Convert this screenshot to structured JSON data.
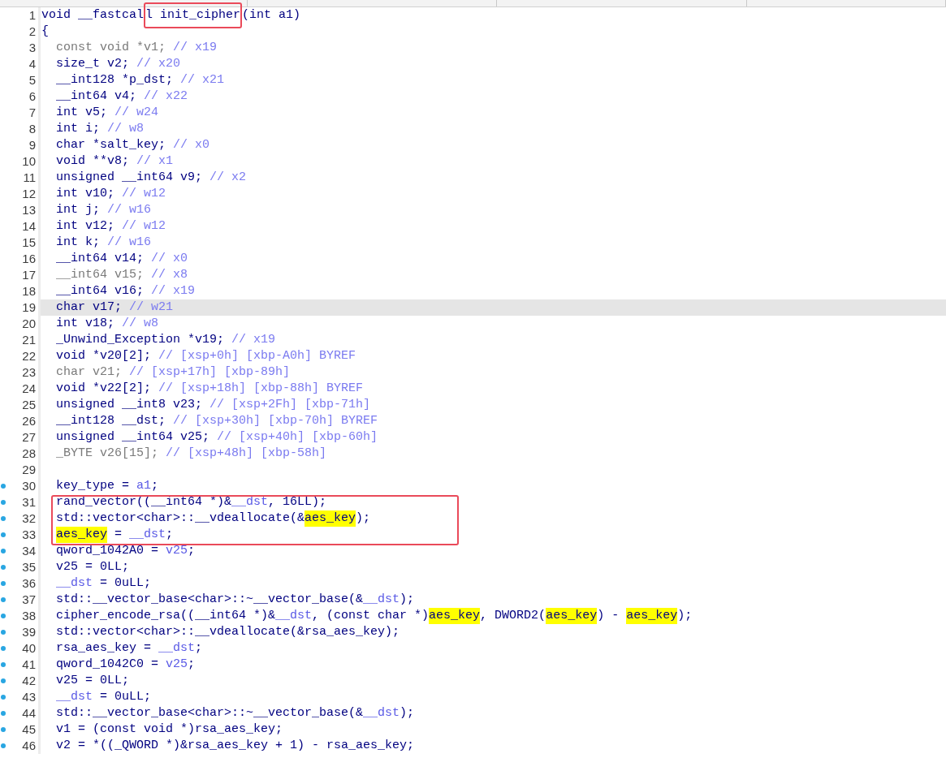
{
  "code_view": {
    "lines": [
      {
        "number": "1",
        "selected": false,
        "marked": false,
        "tokens": [
          {
            "kind": "code",
            "text": "void __fastcal"
          },
          {
            "kind": "boxed",
            "text": "l init_cipher"
          },
          {
            "kind": "code",
            "text": "(int a1)"
          }
        ]
      },
      {
        "number": "2",
        "selected": false,
        "marked": false,
        "tokens": [
          {
            "kind": "code",
            "text": "{"
          }
        ],
        "children": [
          {
            "number": "3",
            "selected": false,
            "marked": false,
            "tokens": [
              {
                "kind": "dim",
                "text": "const void *v1;"
              },
              {
                "kind": "comment",
                "text": " // x19"
              }
            ]
          },
          {
            "number": "4",
            "selected": false,
            "marked": false,
            "tokens": [
              {
                "kind": "code",
                "text": "size_t v2;"
              },
              {
                "kind": "comment",
                "text": " // x20"
              }
            ]
          },
          {
            "number": "5",
            "selected": false,
            "marked": false,
            "tokens": [
              {
                "kind": "code",
                "text": "__int128 *p_dst;"
              },
              {
                "kind": "comment",
                "text": " // x21"
              }
            ]
          },
          {
            "number": "6",
            "selected": false,
            "marked": false,
            "tokens": [
              {
                "kind": "code",
                "text": "__int64 v4;"
              },
              {
                "kind": "comment",
                "text": " // x22"
              }
            ]
          },
          {
            "number": "7",
            "selected": false,
            "marked": false,
            "tokens": [
              {
                "kind": "code",
                "text": "int v5;"
              },
              {
                "kind": "comment",
                "text": " // w24"
              }
            ]
          },
          {
            "number": "8",
            "selected": false,
            "marked": false,
            "tokens": [
              {
                "kind": "code",
                "text": "int i;"
              },
              {
                "kind": "comment",
                "text": " // w8"
              }
            ]
          },
          {
            "number": "9",
            "selected": false,
            "marked": false,
            "tokens": [
              {
                "kind": "code",
                "text": "char *salt_key;"
              },
              {
                "kind": "comment",
                "text": " // x0"
              }
            ]
          },
          {
            "number": "10",
            "selected": false,
            "marked": false,
            "tokens": [
              {
                "kind": "code",
                "text": "void **v8;"
              },
              {
                "kind": "comment",
                "text": " // x1"
              }
            ]
          },
          {
            "number": "11",
            "selected": false,
            "marked": false,
            "tokens": [
              {
                "kind": "code",
                "text": "unsigned __int64 v9;"
              },
              {
                "kind": "comment",
                "text": " // x2"
              }
            ]
          },
          {
            "number": "12",
            "selected": false,
            "marked": false,
            "tokens": [
              {
                "kind": "code",
                "text": "int v10;"
              },
              {
                "kind": "comment",
                "text": " // w12"
              }
            ]
          },
          {
            "number": "13",
            "selected": false,
            "marked": false,
            "tokens": [
              {
                "kind": "code",
                "text": "int j;"
              },
              {
                "kind": "comment",
                "text": " // w16"
              }
            ]
          },
          {
            "number": "14",
            "selected": false,
            "marked": false,
            "tokens": [
              {
                "kind": "code",
                "text": "int v12;"
              },
              {
                "kind": "comment",
                "text": " // w12"
              }
            ]
          },
          {
            "number": "15",
            "selected": false,
            "marked": false,
            "tokens": [
              {
                "kind": "code",
                "text": "int k;"
              },
              {
                "kind": "comment",
                "text": " // w16"
              }
            ]
          },
          {
            "number": "16",
            "selected": false,
            "marked": false,
            "tokens": [
              {
                "kind": "code",
                "text": "__int64 v14;"
              },
              {
                "kind": "comment",
                "text": " // x0"
              }
            ]
          },
          {
            "number": "17",
            "selected": false,
            "marked": false,
            "tokens": [
              {
                "kind": "dim",
                "text": "__int64 v15;"
              },
              {
                "kind": "comment",
                "text": " // x8"
              }
            ]
          },
          {
            "number": "18",
            "selected": false,
            "marked": false,
            "tokens": [
              {
                "kind": "code",
                "text": "__int64 v16;"
              },
              {
                "kind": "comment",
                "text": " // x19"
              }
            ]
          },
          {
            "number": "19",
            "selected": true,
            "marked": false,
            "tokens": [
              {
                "kind": "code",
                "text": "char v17;"
              },
              {
                "kind": "comment",
                "text": " // w21"
              }
            ]
          },
          {
            "number": "20",
            "selected": false,
            "marked": false,
            "tokens": [
              {
                "kind": "code",
                "text": "int v18;"
              },
              {
                "kind": "comment",
                "text": " // w8"
              }
            ]
          },
          {
            "number": "21",
            "selected": false,
            "marked": false,
            "tokens": [
              {
                "kind": "code",
                "text": "_Unwind_Exception *v19;"
              },
              {
                "kind": "comment",
                "text": " // x19"
              }
            ]
          },
          {
            "number": "22",
            "selected": false,
            "marked": false,
            "tokens": [
              {
                "kind": "code",
                "text": "void *v20[2];"
              },
              {
                "kind": "comment",
                "text": " // [xsp+0h] [xbp-A0h] BYREF"
              }
            ]
          },
          {
            "number": "23",
            "selected": false,
            "marked": false,
            "tokens": [
              {
                "kind": "dim",
                "text": "char v21;"
              },
              {
                "kind": "comment",
                "text": " // [xsp+17h] [xbp-89h]"
              }
            ]
          },
          {
            "number": "24",
            "selected": false,
            "marked": false,
            "tokens": [
              {
                "kind": "code",
                "text": "void *v22[2];"
              },
              {
                "kind": "comment",
                "text": " // [xsp+18h] [xbp-88h] BYREF"
              }
            ]
          },
          {
            "number": "25",
            "selected": false,
            "marked": false,
            "tokens": [
              {
                "kind": "code",
                "text": "unsigned __int8 v23;"
              },
              {
                "kind": "comment",
                "text": " // [xsp+2Fh] [xbp-71h]"
              }
            ]
          },
          {
            "number": "26",
            "selected": false,
            "marked": false,
            "tokens": [
              {
                "kind": "code",
                "text": "__int128 __dst;"
              },
              {
                "kind": "comment",
                "text": " // [xsp+30h] [xbp-70h] BYREF"
              }
            ]
          },
          {
            "number": "27",
            "selected": false,
            "marked": false,
            "tokens": [
              {
                "kind": "code",
                "text": "unsigned __int64 v25;"
              },
              {
                "kind": "comment",
                "text": " // [xsp+40h] [xbp-60h]"
              }
            ]
          },
          {
            "number": "28",
            "selected": false,
            "marked": false,
            "tokens": [
              {
                "kind": "dim",
                "text": "_BYTE v26[15];"
              },
              {
                "kind": "comment",
                "text": " // [xsp+48h] [xbp-58h]"
              }
            ]
          },
          {
            "number": "29",
            "selected": false,
            "marked": false
          },
          {
            "number": "30",
            "selected": false,
            "marked": true,
            "tokens": [
              {
                "kind": "code",
                "text": "key_type = "
              },
              {
                "kind": "local",
                "text": "a1"
              },
              {
                "kind": "code",
                "text": ";"
              }
            ]
          },
          {
            "kind": "frame",
            "children": [
              {
                "number": "31",
                "selected": false,
                "marked": true,
                "tokens": [
                  {
                    "kind": "code",
                    "text": "rand_vector((__int64 *)&"
                  },
                  {
                    "kind": "local",
                    "text": "__dst"
                  },
                  {
                    "kind": "code",
                    "text": ", 16LL);"
                  }
                ]
              },
              {
                "number": "32",
                "selected": false,
                "marked": true,
                "tokens": [
                  {
                    "kind": "code",
                    "text": "std::vector<char>::__vdeallocate(&"
                  },
                  {
                    "kind": "highlight",
                    "text": "aes_key"
                  },
                  {
                    "kind": "code",
                    "text": ");"
                  }
                ]
              },
              {
                "number": "33",
                "selected": false,
                "marked": true,
                "tokens": [
                  {
                    "kind": "highlight",
                    "text": "aes_key"
                  },
                  {
                    "kind": "code",
                    "text": " = "
                  },
                  {
                    "kind": "local",
                    "text": "__dst"
                  },
                  {
                    "kind": "code",
                    "text": ";"
                  }
                ]
              }
            ]
          },
          {
            "number": "34",
            "selected": false,
            "marked": true,
            "tokens": [
              {
                "kind": "code",
                "text": "qword_1042A0 = "
              },
              {
                "kind": "local",
                "text": "v25"
              },
              {
                "kind": "code",
                "text": ";"
              }
            ]
          },
          {
            "number": "35",
            "selected": false,
            "marked": true,
            "tokens": [
              {
                "kind": "code",
                "text": "v25 = 0LL;"
              }
            ]
          },
          {
            "number": "36",
            "selected": false,
            "marked": true,
            "tokens": [
              {
                "kind": "local",
                "text": "__dst"
              },
              {
                "kind": "code",
                "text": " = 0uLL;"
              }
            ]
          },
          {
            "number": "37",
            "selected": false,
            "marked": true,
            "tokens": [
              {
                "kind": "code",
                "text": "std::__vector_base<char>::~__vector_base(&"
              },
              {
                "kind": "local",
                "text": "__dst"
              },
              {
                "kind": "code",
                "text": ");"
              }
            ]
          },
          {
            "number": "38",
            "selected": false,
            "marked": true,
            "tokens": [
              {
                "kind": "code",
                "text": "cipher_encode_rsa((__int64 *)&"
              },
              {
                "kind": "local",
                "text": "__dst"
              },
              {
                "kind": "code",
                "text": ", (const char *)"
              },
              {
                "kind": "highlight",
                "text": "aes_key"
              },
              {
                "kind": "code",
                "text": ", DWORD2("
              },
              {
                "kind": "highlight",
                "text": "aes_key"
              },
              {
                "kind": "code",
                "text": ") - "
              },
              {
                "kind": "highlight",
                "text": "aes_key"
              },
              {
                "kind": "code",
                "text": ");"
              }
            ]
          },
          {
            "number": "39",
            "selected": false,
            "marked": true,
            "tokens": [
              {
                "kind": "code",
                "text": "std::vector<char>::__vdeallocate(&rsa_aes_key);"
              }
            ]
          },
          {
            "number": "40",
            "selected": false,
            "marked": true,
            "tokens": [
              {
                "kind": "code",
                "text": "rsa_aes_key = "
              },
              {
                "kind": "local",
                "text": "__dst"
              },
              {
                "kind": "code",
                "text": ";"
              }
            ]
          },
          {
            "number": "41",
            "selected": false,
            "marked": true,
            "tokens": [
              {
                "kind": "code",
                "text": "qword_1042C0 = "
              },
              {
                "kind": "local",
                "text": "v25"
              },
              {
                "kind": "code",
                "text": ";"
              }
            ]
          },
          {
            "number": "42",
            "selected": false,
            "marked": true,
            "tokens": [
              {
                "kind": "code",
                "text": "v25 = 0LL;"
              }
            ]
          },
          {
            "number": "43",
            "selected": false,
            "marked": true,
            "tokens": [
              {
                "kind": "local",
                "text": "__dst"
              },
              {
                "kind": "code",
                "text": " = 0uLL;"
              }
            ]
          },
          {
            "number": "44",
            "selected": false,
            "marked": true,
            "tokens": [
              {
                "kind": "code",
                "text": "std::__vector_base<char>::~__vector_base(&"
              },
              {
                "kind": "local",
                "text": "__dst"
              },
              {
                "kind": "code",
                "text": ");"
              }
            ]
          },
          {
            "number": "45",
            "selected": false,
            "marked": true,
            "tokens": [
              {
                "kind": "code",
                "text": "v1 = (const void *)rsa_aes_key;"
              }
            ]
          },
          {
            "number": "46",
            "selected": false,
            "marked": true,
            "tokens": [
              {
                "kind": "code",
                "text": "v2 = *((_QWORD *)&rsa_aes_key + 1) - rsa_aes_key;"
              }
            ]
          }
        ]
      }
    ]
  }
}
